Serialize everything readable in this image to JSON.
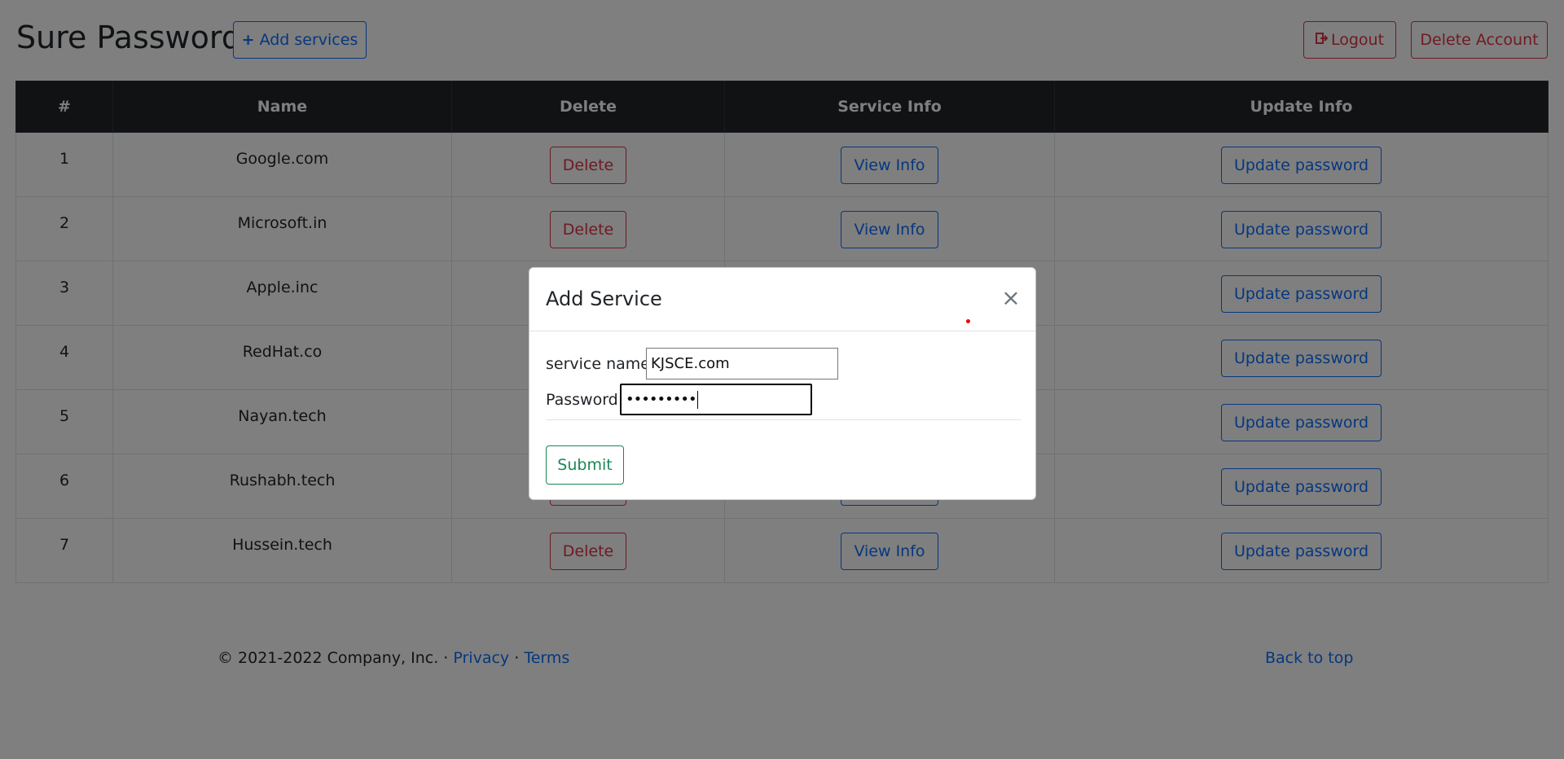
{
  "header": {
    "title": "Sure Password",
    "add_label": "Add services",
    "add_icon": "plus-icon",
    "logout_label": "Logout",
    "logout_icon": "sign-out-icon",
    "delete_account_label": "Delete Account"
  },
  "table": {
    "columns": [
      "#",
      "Name",
      "Delete",
      "Service Info",
      "Update Info"
    ],
    "delete_label": "Delete",
    "view_label": "View Info",
    "update_label": "Update password",
    "rows": [
      {
        "num": "1",
        "name": "Google.com"
      },
      {
        "num": "2",
        "name": "Microsoft.in"
      },
      {
        "num": "3",
        "name": "Apple.inc"
      },
      {
        "num": "4",
        "name": "RedHat.co"
      },
      {
        "num": "5",
        "name": "Nayan.tech"
      },
      {
        "num": "6",
        "name": "Rushabh.tech"
      },
      {
        "num": "7",
        "name": "Hussein.tech"
      }
    ]
  },
  "footer": {
    "copyright": "© 2021-2022 Company, Inc. ·",
    "privacy": "Privacy",
    "separator": "·",
    "terms": "Terms",
    "back_to_top": "Back to top"
  },
  "modal": {
    "title": "Add Service",
    "close_symbol": "×",
    "service_label": "service name:",
    "service_value": "KJSCE.com",
    "password_label": "Password:",
    "password_masked": "•••••••••",
    "submit_label": "Submit"
  },
  "colors": {
    "primary": "#0d6efd",
    "danger": "#dc3545",
    "success": "#198754",
    "table_header": "#212529"
  }
}
